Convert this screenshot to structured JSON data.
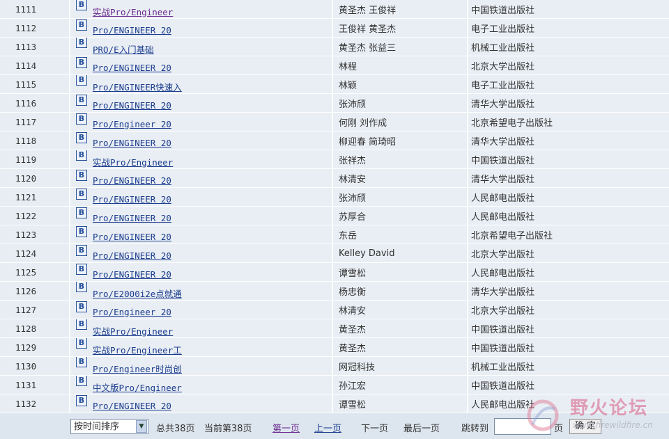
{
  "rows": [
    {
      "no": "1111",
      "title": "实战Pro/Engineer",
      "visited": true,
      "author": "黄圣杰 王俊祥",
      "publisher": "中国铁道出版社"
    },
    {
      "no": "1112",
      "title": "Pro/ENGINEER 20",
      "visited": false,
      "author": "王俊祥 黄圣杰",
      "publisher": "电子工业出版社"
    },
    {
      "no": "1113",
      "title": "PRO/E入门基础",
      "visited": false,
      "author": "黄圣杰 张益三",
      "publisher": "机械工业出版社"
    },
    {
      "no": "1114",
      "title": "Pro/ENGINEER 20",
      "visited": false,
      "author": "林程",
      "publisher": "北京大学出版社"
    },
    {
      "no": "1115",
      "title": "Pro/ENGINEER快速入",
      "visited": false,
      "author": "林颖",
      "publisher": "电子工业出版社"
    },
    {
      "no": "1116",
      "title": "Pro/ENGINEER 20",
      "visited": false,
      "author": "张沛颀",
      "publisher": "清华大学出版社"
    },
    {
      "no": "1117",
      "title": "Pro/Engineer 20",
      "visited": false,
      "author": "何刚 刘作成",
      "publisher": "北京希望电子出版社"
    },
    {
      "no": "1118",
      "title": "Pro/ENGINEER 20",
      "visited": false,
      "author": "柳迎春 简琦昭",
      "publisher": "清华大学出版社"
    },
    {
      "no": "1119",
      "title": "实战Pro/Engineer",
      "visited": false,
      "author": "张祥杰",
      "publisher": "中国铁道出版社"
    },
    {
      "no": "1120",
      "title": "Pro/ENGINEER 20",
      "visited": false,
      "author": "林清安",
      "publisher": "清华大学出版社"
    },
    {
      "no": "1121",
      "title": "Pro/ENGINEER 20",
      "visited": false,
      "author": "张沛颀",
      "publisher": "人民邮电出版社"
    },
    {
      "no": "1122",
      "title": "Pro/ENGINEER 20",
      "visited": false,
      "author": "苏厚合",
      "publisher": "人民邮电出版社"
    },
    {
      "no": "1123",
      "title": "Pro/ENGINEER 20",
      "visited": false,
      "author": "东岳",
      "publisher": "北京希望电子出版社"
    },
    {
      "no": "1124",
      "title": "Pro/ENGINEER 20",
      "visited": false,
      "author": "Kelley David",
      "publisher": "北京大学出版社"
    },
    {
      "no": "1125",
      "title": "Pro/ENGINEER 20",
      "visited": false,
      "author": "谭雪松",
      "publisher": "人民邮电出版社"
    },
    {
      "no": "1126",
      "title": "Pro/E2000i2e点就通",
      "visited": false,
      "author": "杨忠衡",
      "publisher": "清华大学出版社"
    },
    {
      "no": "1127",
      "title": "Pro/Engineer 20",
      "visited": false,
      "author": "林清安",
      "publisher": "北京大学出版社"
    },
    {
      "no": "1128",
      "title": "实战Pro/Engineer",
      "visited": false,
      "author": "黄圣杰",
      "publisher": "中国铁道出版社"
    },
    {
      "no": "1129",
      "title": "实战Pro/Engineer工",
      "visited": false,
      "author": "黄圣杰",
      "publisher": "中国铁道出版社"
    },
    {
      "no": "1130",
      "title": "Pro/Engineer时尚创",
      "visited": false,
      "author": "网冠科技",
      "publisher": "机械工业出版社"
    },
    {
      "no": "1131",
      "title": "中文版Pro/Engineer",
      "visited": false,
      "author": "孙江宏",
      "publisher": "中国铁道出版社"
    },
    {
      "no": "1132",
      "title": "Pro/ENGINEER 20",
      "visited": false,
      "author": "谭雪松",
      "publisher": "人民邮电出版社"
    }
  ],
  "row_icon": {
    "glyph": "B",
    "icon": "book-icon"
  },
  "pager": {
    "sort_selected": "按时间排序",
    "total_pages": "总共38页",
    "current_page": "当前第38页",
    "first": "第一页",
    "prev": "上一页",
    "next": "下一页",
    "last": "最后一页",
    "jump_to": "跳转到",
    "page_unit": "页",
    "confirm": "确 定"
  },
  "watermark": {
    "name": "野火论坛",
    "url": "www.firewildfire.cn"
  }
}
